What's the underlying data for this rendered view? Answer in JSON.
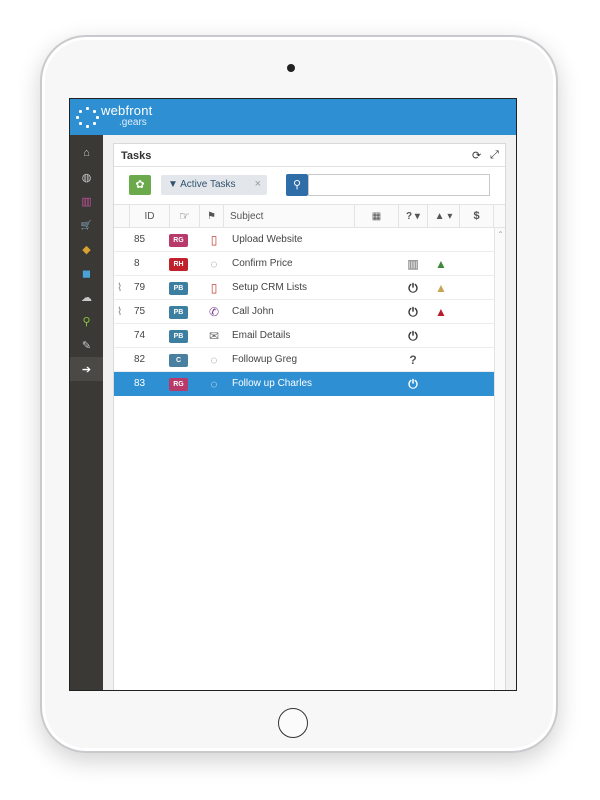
{
  "app": {
    "logo_main": "webfront",
    "logo_sub": ".gears",
    "brand_color": "#2e8fd3"
  },
  "sidebar": {
    "items": [
      {
        "icon": "home-icon",
        "glyph": "⌂"
      },
      {
        "icon": "dashboard-icon",
        "glyph": "◍"
      },
      {
        "icon": "bar-chart-icon",
        "glyph": "▥"
      },
      {
        "icon": "cart-icon",
        "glyph": "🛒"
      },
      {
        "icon": "tags-icon",
        "glyph": "◆"
      },
      {
        "icon": "cube-icon",
        "glyph": "◼"
      },
      {
        "icon": "cloud-download-icon",
        "glyph": "☁"
      },
      {
        "icon": "map-marker-icon",
        "glyph": "⚲"
      },
      {
        "icon": "wrench-icon",
        "glyph": "✎"
      },
      {
        "icon": "arrow-circle-right-icon",
        "glyph": "➔"
      }
    ]
  },
  "panel": {
    "title": "Tasks",
    "refresh_icon": "⟳",
    "expand_icon": "⤢"
  },
  "toolbar": {
    "settings_glyph": "✿",
    "filter_label": "▼ Active Tasks",
    "filter_close": "×",
    "search_glyph": "⚲",
    "search_value": ""
  },
  "grid": {
    "headers": {
      "id": "ID",
      "owner_icon": "☞",
      "type_icon": "⚑",
      "subject": "Subject",
      "date_icon": "▦",
      "status_icon": "? ▾",
      "priority_icon": "▲ ▾",
      "cost_icon": "$"
    },
    "rows": [
      {
        "attach": "",
        "id": "85",
        "badge": "RG",
        "badge_color": "#b83a6a",
        "type": "▯",
        "type_color": "#c0413c",
        "subject": "Upload Website",
        "status": "",
        "status_color": "#333",
        "priority": "",
        "priority_color": "#333",
        "selected": false
      },
      {
        "attach": "",
        "id": "8",
        "badge": "RH",
        "badge_color": "#c0212b",
        "type": "◌",
        "type_color": "#777",
        "subject": "Confirm Price",
        "status": "▥",
        "status_color": "#999",
        "priority": "▲",
        "priority_color": "#3f8a3a",
        "selected": false
      },
      {
        "attach": "⌇",
        "id": "79",
        "badge": "PB",
        "badge_color": "#3d7fa0",
        "type": "▯",
        "type_color": "#c0413c",
        "subject": "Setup CRM Lists",
        "status": "⏻",
        "status_color": "#333",
        "priority": "▲",
        "priority_color": "#c9a457",
        "selected": false
      },
      {
        "attach": "⌇",
        "id": "75",
        "badge": "PB",
        "badge_color": "#3d7fa0",
        "type": "✆",
        "type_color": "#7a3f93",
        "subject": "Call John",
        "status": "⏻",
        "status_color": "#333",
        "priority": "▲",
        "priority_color": "#b51f2a",
        "selected": false
      },
      {
        "attach": "",
        "id": "74",
        "badge": "PB",
        "badge_color": "#3d7fa0",
        "type": "✉",
        "type_color": "#666",
        "subject": "Email Details",
        "status": "⏻",
        "status_color": "#333",
        "priority": "",
        "priority_color": "#333",
        "selected": false
      },
      {
        "attach": "",
        "id": "82",
        "badge": "C",
        "badge_color": "#4a7fa0",
        "type": "◌",
        "type_color": "#777",
        "subject": "Followup Greg",
        "status": "?",
        "status_color": "#555",
        "priority": "",
        "priority_color": "#333",
        "selected": false
      },
      {
        "attach": "",
        "id": "83",
        "badge": "RG",
        "badge_color": "#b83a6a",
        "type": "◌",
        "type_color": "#ffffff",
        "subject": "Follow up Charles",
        "status": "⏻",
        "status_color": "#ffffff",
        "priority": "",
        "priority_color": "#ffffff",
        "selected": true
      }
    ]
  }
}
